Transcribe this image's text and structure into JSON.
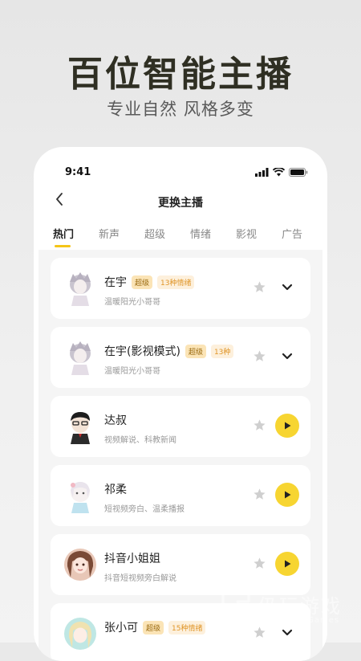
{
  "hero": {
    "title": "百位智能主播",
    "subtitle": "专业自然 风格多变"
  },
  "status_bar": {
    "time": "9:41"
  },
  "nav": {
    "title": "更换主播"
  },
  "tabs": [
    {
      "label": "热门",
      "active": true
    },
    {
      "label": "新声",
      "active": false
    },
    {
      "label": "超级",
      "active": false
    },
    {
      "label": "情绪",
      "active": false
    },
    {
      "label": "影视",
      "active": false
    },
    {
      "label": "广告",
      "active": false
    }
  ],
  "anchors": [
    {
      "name": "在宇",
      "badge": "超级",
      "emotion": "13种情绪",
      "desc": "温暖阳光小哥哥",
      "action": "chevron-down-icon"
    },
    {
      "name": "在宇(影视模式)",
      "badge": "超级",
      "emotion": "13种",
      "desc": "温暖阳光小哥哥",
      "action": "chevron-down-icon"
    },
    {
      "name": "达叔",
      "badge": "",
      "emotion": "",
      "desc": "视频解说、科教新闻",
      "action": "play-icon"
    },
    {
      "name": "祁柔",
      "badge": "",
      "emotion": "",
      "desc": "短视频旁白、温柔播报",
      "action": "play-icon"
    },
    {
      "name": "抖音小姐姐",
      "badge": "",
      "emotion": "",
      "desc": "抖音短视频旁白解说",
      "action": "play-icon"
    },
    {
      "name": "张小可",
      "badge": "超级",
      "emotion": "15种情绪",
      "desc": "",
      "action": "chevron-down-icon"
    }
  ],
  "watermark": {
    "cn": "仍玩游戏",
    "en": "Rengwan Games"
  },
  "colors": {
    "accent": "#f5c518",
    "play": "#f7d531",
    "badge_bg": "#fbe4b6"
  }
}
